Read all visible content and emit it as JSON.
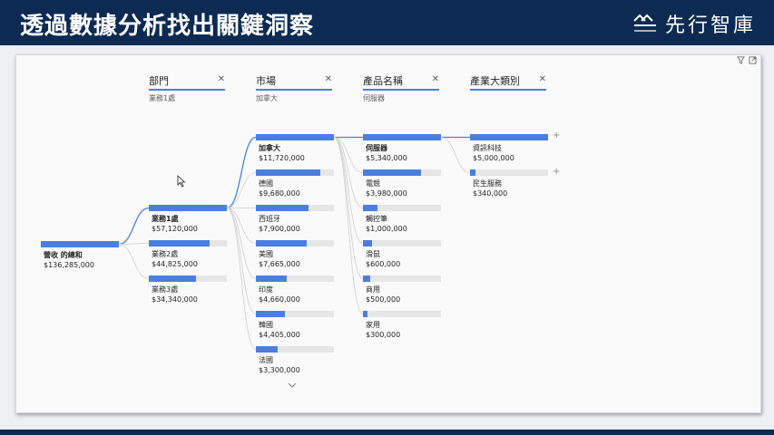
{
  "header": {
    "title": "透過數據分析找出關鍵洞察",
    "brand": "先行智庫"
  },
  "columns": [
    {
      "title": "部門",
      "subtitle": "業務1處"
    },
    {
      "title": "市場",
      "subtitle": "加拿大"
    },
    {
      "title": "產品名稱",
      "subtitle": "伺服器"
    },
    {
      "title": "產業大類別",
      "subtitle": ""
    }
  ],
  "chart_data": {
    "type": "decomposition-tree",
    "root": {
      "label": "營收 的總和",
      "value": "$136,285,000",
      "amount": 136285000
    },
    "levels": [
      {
        "name": "部門",
        "nodes": [
          {
            "label": "業務1處",
            "value": "$57,120,000",
            "amount": 57120000,
            "selected": true
          },
          {
            "label": "業務2處",
            "value": "$44,825,000",
            "amount": 44825000
          },
          {
            "label": "業務3處",
            "value": "$34,340,000",
            "amount": 34340000
          }
        ]
      },
      {
        "name": "市場",
        "nodes": [
          {
            "label": "加拿大",
            "value": "$11,720,000",
            "amount": 11720000,
            "selected": true
          },
          {
            "label": "德國",
            "value": "$9,680,000",
            "amount": 9680000
          },
          {
            "label": "西班牙",
            "value": "$7,900,000",
            "amount": 7900000
          },
          {
            "label": "美國",
            "value": "$7,665,000",
            "amount": 7665000
          },
          {
            "label": "印度",
            "value": "$4,660,000",
            "amount": 4660000
          },
          {
            "label": "韓國",
            "value": "$4,405,000",
            "amount": 4405000
          },
          {
            "label": "法國",
            "value": "$3,300,000",
            "amount": 3300000
          }
        ]
      },
      {
        "name": "產品名稱",
        "nodes": [
          {
            "label": "伺服器",
            "value": "$5,340,000",
            "amount": 5340000,
            "selected": true
          },
          {
            "label": "電競",
            "value": "$3,980,000",
            "amount": 3980000
          },
          {
            "label": "觸控筆",
            "value": "$1,000,000",
            "amount": 1000000
          },
          {
            "label": "滑鼠",
            "value": "$600,000",
            "amount": 600000
          },
          {
            "label": "商用",
            "value": "$500,000",
            "amount": 500000
          },
          {
            "label": "家用",
            "value": "$300,000",
            "amount": 300000
          }
        ]
      },
      {
        "name": "產業大類別",
        "nodes": [
          {
            "label": "資訊科技",
            "value": "$5,000,000",
            "amount": 5000000
          },
          {
            "label": "民生服務",
            "value": "$340,000",
            "amount": 340000
          }
        ]
      }
    ]
  },
  "colors": {
    "header_bg": "#0d2a52",
    "bar": "#4a7fe0",
    "track": "#e6e6e6",
    "underline": "#4a7fd9"
  },
  "icons": {
    "filter": "filter-icon",
    "expand": "focus-mode-icon",
    "close": "close-icon",
    "plus": "plus-icon",
    "more": "chevron-down-icon"
  }
}
